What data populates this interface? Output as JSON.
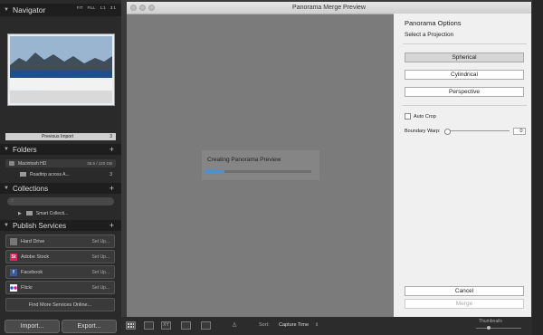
{
  "navigator": {
    "title": "Navigator",
    "zoom_options": [
      "FIT",
      "FILL",
      "1:1",
      "3:1"
    ]
  },
  "previous_import": {
    "label": "Previous Import",
    "count": "3"
  },
  "folders": {
    "title": "Folders",
    "volume": {
      "name": "Macintosh HD",
      "capacity": "36.6 / 120 GB"
    },
    "items": [
      {
        "name": "Roadtrip across A...",
        "count": "3"
      }
    ]
  },
  "collections": {
    "title": "Collections",
    "search_placeholder": "",
    "items": [
      {
        "name": "Smart Collecti..."
      }
    ]
  },
  "publish_services": {
    "title": "Publish Services",
    "services": [
      {
        "name": "Hard Drive",
        "action": "Set Up...",
        "icon": "hard-drive-icon"
      },
      {
        "name": "Adobe Stock",
        "action": "Set Up...",
        "icon": "adobe-stock-icon"
      },
      {
        "name": "Facebook",
        "action": "Set Up...",
        "icon": "facebook-icon"
      },
      {
        "name": "Flickr",
        "action": "Set Up...",
        "icon": "flickr-icon"
      }
    ],
    "find_more": "Find More Services Online..."
  },
  "buttons": {
    "import": "Import...",
    "export": "Export..."
  },
  "dialog": {
    "title": "Panorama Merge Preview",
    "progress_label": "Creating Panorama Preview",
    "progress": 0.18,
    "options": {
      "title": "Panorama Options",
      "subtitle": "Select a Projection",
      "projections": [
        "Spherical",
        "Cylindrical",
        "Perspective"
      ],
      "selected": "Spherical",
      "auto_crop": "Auto Crop",
      "boundary_warp": "Boundary Warp:",
      "boundary_warp_value": "0",
      "cancel": "Cancel",
      "merge": "Merge"
    }
  },
  "toolbar": {
    "sort_label": "Sort:",
    "sort_value": "Capture Time",
    "thumbnails_label": "Thumbnails"
  },
  "colors": {
    "accent": "#4a90d9",
    "adobe_stock": "#e0245e",
    "facebook": "#3b5998"
  }
}
